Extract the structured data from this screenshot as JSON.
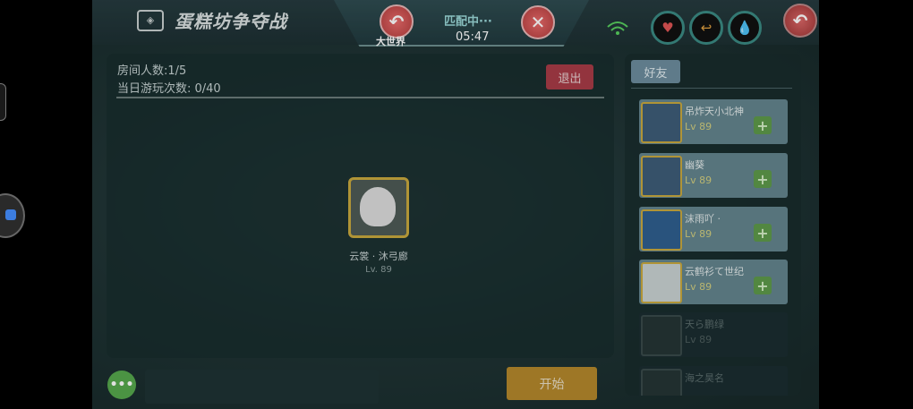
{
  "title": "蛋糕坊争夺战",
  "title_logo": "◈",
  "match": {
    "back_label": "大世界",
    "status": "匹配中···",
    "timer": "05:47"
  },
  "icons": {
    "back": "↶",
    "close": "✕",
    "wifi": "wifi-signal-icon",
    "heart": "♥",
    "arrow": "↩",
    "drop": "💧"
  },
  "room": {
    "count_label": "房间人数:1/5",
    "plays_label": "当日游玩次数: 0/40",
    "exit_label": "退出",
    "player": {
      "name": "云裳 · 沐弓廊",
      "level": "Lv. 89"
    }
  },
  "chat": {
    "dots_label": "•••",
    "input_value": ""
  },
  "start_label": "开始",
  "friends": {
    "tab_label": "好友",
    "add_symbol": "+",
    "list": [
      {
        "name": "吊炸天小北神",
        "level": "Lv 89",
        "online": true
      },
      {
        "name": "幽葵",
        "level": "Lv 89",
        "online": true
      },
      {
        "name": "沫雨吖 ·",
        "level": "Lv 89",
        "online": true
      },
      {
        "name": "云鹤衫て世纪",
        "level": "Lv 89",
        "online": true
      },
      {
        "name": "天ら鹏绿",
        "level": "Lv 89",
        "online": false
      },
      {
        "name": "海之昊名",
        "level": "",
        "online": false
      }
    ]
  },
  "colors": {
    "accent_red": "#b33d3d",
    "accent_gold": "#c9a93e",
    "online_green": "#58d05f"
  }
}
